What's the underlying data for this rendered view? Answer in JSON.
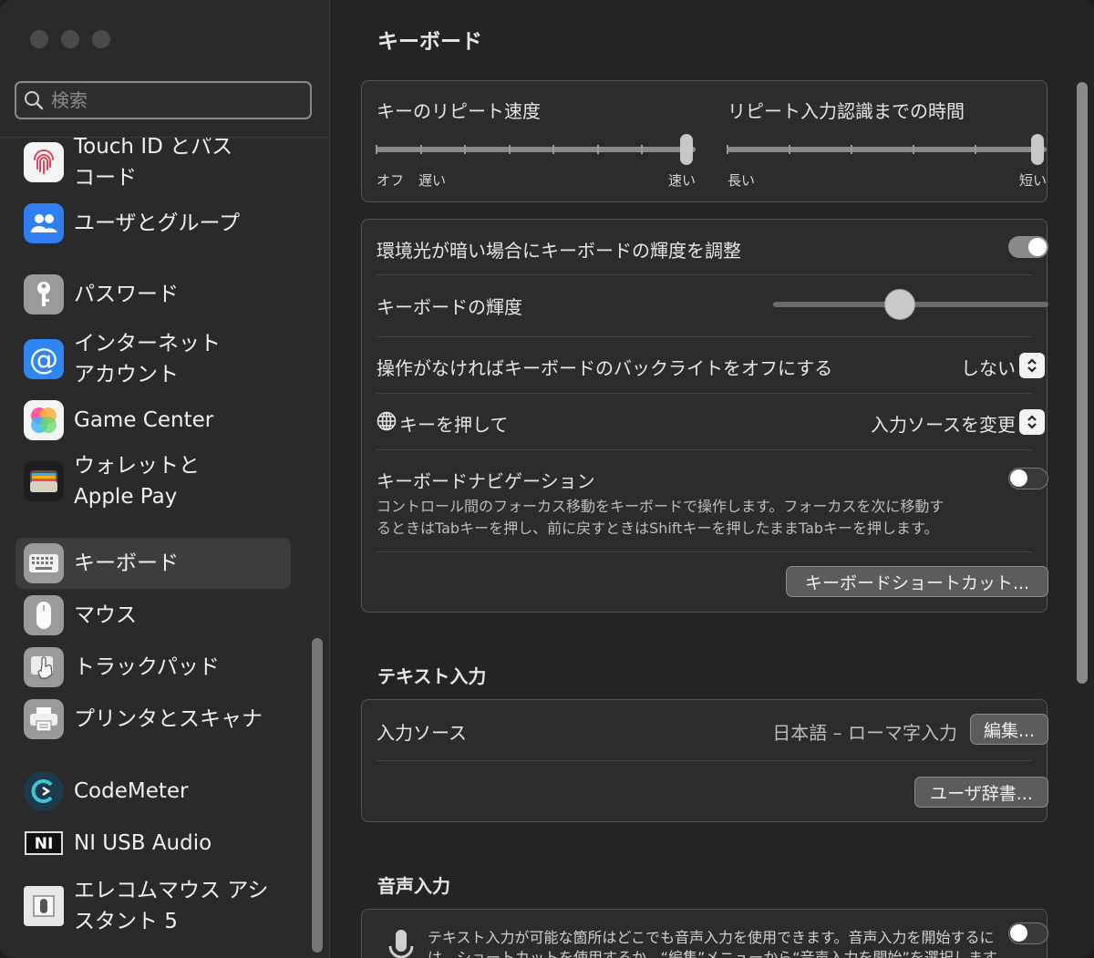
{
  "search": {
    "placeholder": "検索"
  },
  "sidebar": {
    "items": [
      {
        "label": "Touch ID とパス\nコード",
        "icon": "fingerprint-icon"
      },
      {
        "label": "ユーザとグループ",
        "icon": "users-icon"
      },
      {
        "label": "パスワード",
        "icon": "key-icon"
      },
      {
        "label": "インターネット\nアカウント",
        "icon": "at-sign-icon"
      },
      {
        "label": "Game Center",
        "icon": "game-center-icon"
      },
      {
        "label": "ウォレットと\nApple Pay",
        "icon": "wallet-icon"
      },
      {
        "label": "キーボード",
        "icon": "keyboard-icon"
      },
      {
        "label": "マウス",
        "icon": "mouse-icon"
      },
      {
        "label": "トラックパッド",
        "icon": "trackpad-icon"
      },
      {
        "label": "プリンタとスキャナ",
        "icon": "printer-icon"
      },
      {
        "label": "CodeMeter",
        "icon": "codemeter-icon"
      },
      {
        "label": "NI USB Audio",
        "icon": "ni-icon"
      },
      {
        "label": "エレコムマウス アシ\nスタント 5",
        "icon": "elecom-icon"
      }
    ],
    "active_index": 6
  },
  "page": {
    "title": "キーボード"
  },
  "repeat": {
    "key_repeat_label": "キーのリピート速度",
    "key_repeat_off": "オフ",
    "key_repeat_slow": "遅い",
    "key_repeat_fast": "速い",
    "key_repeat_value": 1.0,
    "delay_label": "リピート入力認識までの時間",
    "delay_long": "長い",
    "delay_short": "短い",
    "delay_value": 1.0
  },
  "brightness": {
    "auto_label": "環境光が暗い場合にキーボードの輝度を調整",
    "auto_on": true,
    "brightness_label": "キーボードの輝度",
    "brightness_value": 0.46,
    "backlight_label": "操作がなければキーボードのバックライトをオフにする",
    "backlight_value": "しない",
    "globe_label": "キーを押して",
    "globe_value": "入力ソースを変更",
    "nav_label": "キーボードナビゲーション",
    "nav_desc_1": "コントロール間のフォーカス移動をキーボードで操作します。フォーカスを次に移動す",
    "nav_desc_2": "るときはTabキーを押し、前に戻すときはShiftキーを押したままTabキーを押します。",
    "nav_on": false,
    "shortcuts_button": "キーボードショートカット..."
  },
  "text_input": {
    "section_title": "テキスト入力",
    "source_label": "入力ソース",
    "source_value": "日本語 – ローマ字入力",
    "edit_button": "編集...",
    "dict_button": "ユーザ辞書..."
  },
  "dictation": {
    "section_title": "音声入力",
    "desc_1": "テキスト入力が可能な箇所はどこでも音声入力を使用できます。音声入力を開始するに",
    "desc_2": "は、ショートカットを使用するか、“編集”メニューから“音声入力を開始”を選択します。",
    "on": false
  },
  "colors": {
    "accent": "#8a8a8a",
    "sidebar_bg": "#2a2a2a",
    "main_bg": "#242424"
  }
}
